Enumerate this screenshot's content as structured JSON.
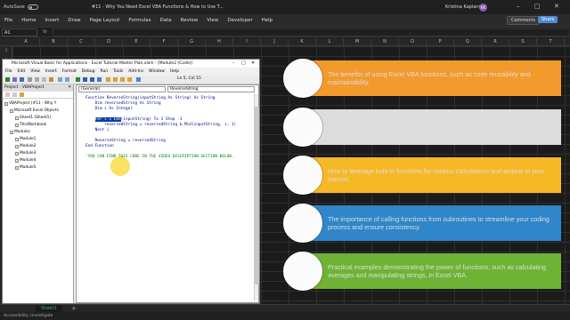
{
  "titlebar": {
    "autosave": "AutoSave",
    "toggle": "Off",
    "title": "#11 - Why You Need Excel VBA Functions & How to Use T...",
    "user": "Kristina Kaplanis",
    "avatar": "KK"
  },
  "ribbon": {
    "tabs": [
      "File",
      "Home",
      "Insert",
      "Draw",
      "Page Layout",
      "Formulas",
      "Data",
      "Review",
      "View",
      "Developer",
      "Help"
    ],
    "comments": "Comments",
    "share": "Share"
  },
  "formula_bar": {
    "name_box": "A1",
    "fx": "fx"
  },
  "columns": [
    "A",
    "B",
    "C",
    "D",
    "E",
    "F",
    "G",
    "H",
    "I",
    "J",
    "K",
    "L",
    "M",
    "N",
    "O",
    "P",
    "Q",
    "R",
    "S",
    "T",
    "U"
  ],
  "rows": [
    "1",
    "2",
    "3",
    "4",
    "5",
    "6",
    "7",
    "8",
    "9",
    "10",
    "11",
    "12",
    "13",
    "14",
    "15",
    "16",
    "17",
    "18",
    "19",
    "20",
    "21",
    "22",
    "23",
    "24",
    "25"
  ],
  "vba": {
    "title": "Microsoft Visual Basic for Applications - Excel Tutorial Master Plan.xlsm - [Module2 (Code)]",
    "menu": [
      "File",
      "Edit",
      "View",
      "Insert",
      "Format",
      "Debug",
      "Run",
      "Tools",
      "Add-Ins",
      "Window",
      "Help"
    ],
    "position": "Ln 5, Col 15",
    "project_title": "Project - VBAProject",
    "tree": [
      "VBAProject (#11 - Why Y",
      "Microsoft Excel Objects",
      "Sheet1 (Sheet1)",
      "ThisWorkbook",
      "Modules",
      "Module1",
      "Module2",
      "Module3",
      "Module4",
      "Module5"
    ],
    "dropdown_left": "(General)",
    "dropdown_right": "ReverseString",
    "code": [
      "Function ReverseString(inputString As String) As String",
      "    Dim reversedString As String",
      "    Dim i As Integer",
      "",
      "    ",
      "        reversedString = reversedString & Mid(inputString, i, 1)",
      "    Next i",
      "",
      "    ReverseString = reversedString",
      "End Function",
      "",
      "'YOU CAN FIND THIS CODE IN THE VIDEO DESCRIPTION SECTION BELOW."
    ],
    "code_for_selected": "For i = Len",
    "code_for_rest": "(inputString) To 1 Step -1"
  },
  "callouts": [
    {
      "text": "The benefits of using Excel VBA functions, such as code reusability and maintainability.",
      "color": "#f39a2d"
    },
    {
      "text": "The syntax of functions in VBA and how to create custom functions tailored to your needs.",
      "color": "#dcdcdc"
    },
    {
      "text": "How to leverage built-in functions for various calculations and actions in your macros.",
      "color": "#f6b825"
    },
    {
      "text": "The importance of calling functions from subroutines to streamline your coding process and ensure consistency.",
      "color": "#2f86c9"
    },
    {
      "text": "Practical examples demonstrating the power of functions, such as calculating averages and manipulating strings, in Excel VBA.",
      "color": "#6fb335"
    }
  ],
  "sheet_tab": "Sheet1",
  "status": "Accessibility: Investigate"
}
